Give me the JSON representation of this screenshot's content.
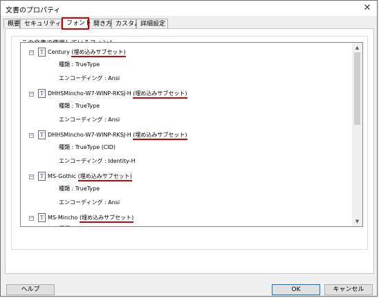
{
  "window": {
    "title": "文書のプロパティ",
    "close_glyph": "✕"
  },
  "tabs": [
    {
      "label": "概要"
    },
    {
      "label": "セキュリティ"
    },
    {
      "label": "フォント",
      "active": true
    },
    {
      "label": "開き方"
    },
    {
      "label": "カスタム"
    },
    {
      "label": "詳細設定"
    }
  ],
  "group": {
    "label": "この文書で使用しているフォント"
  },
  "fonts": [
    {
      "name": "Century ",
      "embed": "(埋め込みサブセット)",
      "type": "種類 : TrueType",
      "encoding": "エンコーディング : Ansi"
    },
    {
      "name": "DHHSMincho-W7-WINP-RKSJ-H ",
      "embed": "(埋め込みサブセット)",
      "type": "種類 : TrueType",
      "encoding": "エンコーディング : Ansi"
    },
    {
      "name": "DHHSMincho-W7-WINP-RKSJ-H ",
      "embed": "(埋め込みサブセット)",
      "type": "種類 : TrueType (CID)",
      "encoding": "エンコーディング : Identity-H"
    },
    {
      "name": "MS-Gothic ",
      "embed": "(埋め込みサブセット)",
      "type": "種類 : TrueType",
      "encoding": "エンコーディング : Ansi"
    },
    {
      "name": "MS-Mincho ",
      "embed": "(埋め込みサブセット)",
      "type": "種類 : TrueType",
      "encoding": ""
    }
  ],
  "icons": {
    "expander": "−",
    "font": "T",
    "scroll_up": "▲",
    "scroll_down": "▼"
  },
  "buttons": {
    "help": "ヘルプ",
    "ok": "OK",
    "cancel": "キャンセル"
  },
  "colors": {
    "highlight": "#d40000"
  }
}
